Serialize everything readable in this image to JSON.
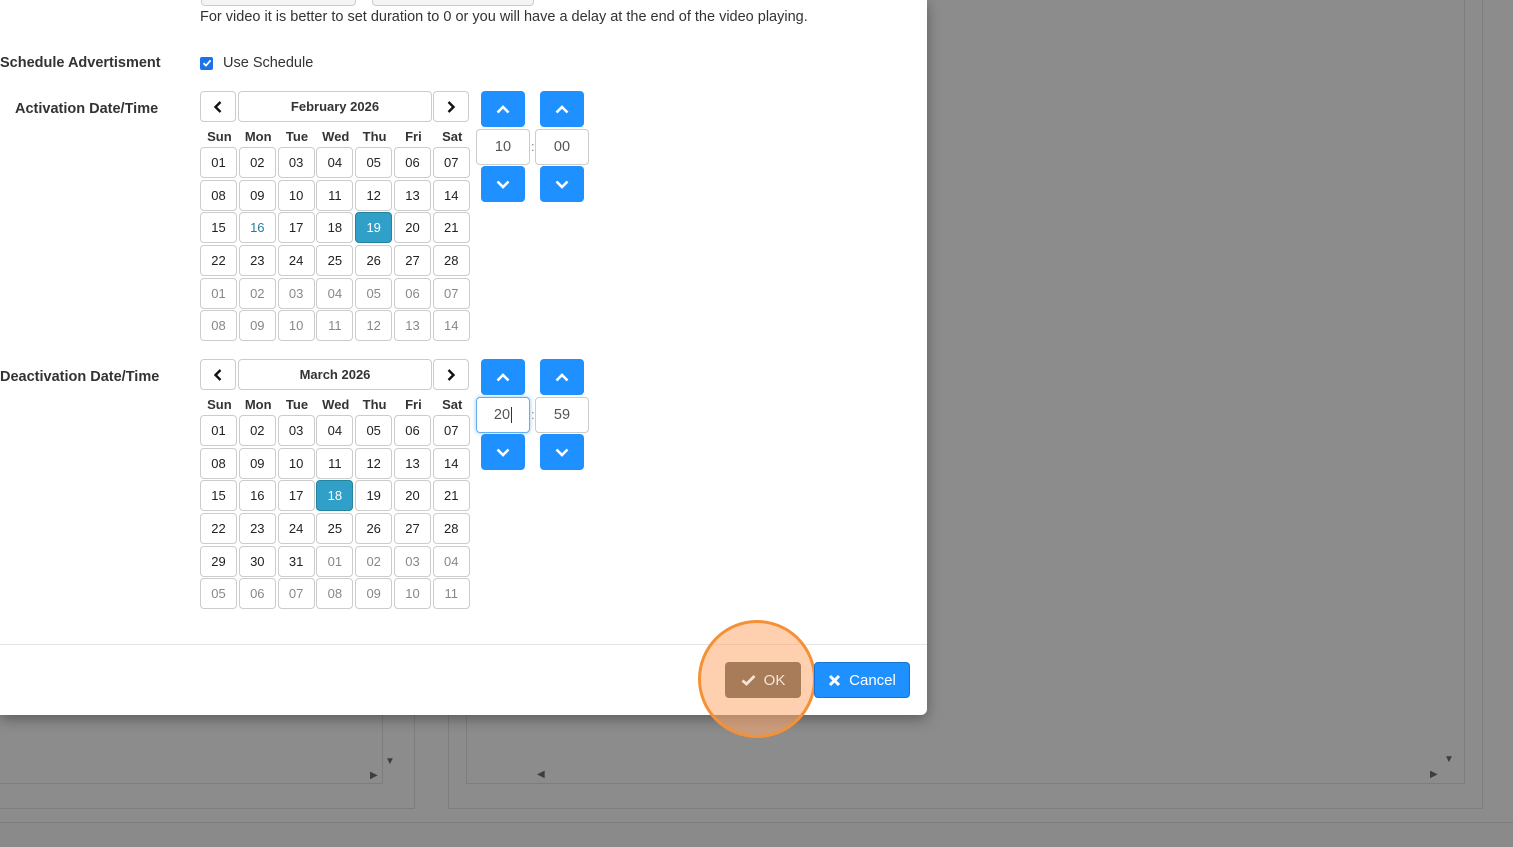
{
  "colors": {
    "accent": "#1e90ff",
    "selected_day": "#30a0c8",
    "highlight_ring": "#f59036",
    "ok_button": "#a87c59"
  },
  "help_text": "For video it is better to set duration to 0 or you will have a delay at the end of the video playing.",
  "schedule": {
    "label": "Schedule Advertisment",
    "checkbox_label": "Use Schedule",
    "checked": true
  },
  "activation": {
    "label": "Activation Date/Time",
    "calendar": {
      "month_label": "February 2026",
      "dows": [
        "Sun",
        "Mon",
        "Tue",
        "Wed",
        "Thu",
        "Fri",
        "Sat"
      ],
      "days": [
        {
          "d": "01",
          "s": "normal"
        },
        {
          "d": "02",
          "s": "normal"
        },
        {
          "d": "03",
          "s": "normal"
        },
        {
          "d": "04",
          "s": "normal"
        },
        {
          "d": "05",
          "s": "normal"
        },
        {
          "d": "06",
          "s": "normal"
        },
        {
          "d": "07",
          "s": "normal"
        },
        {
          "d": "08",
          "s": "normal"
        },
        {
          "d": "09",
          "s": "normal"
        },
        {
          "d": "10",
          "s": "normal"
        },
        {
          "d": "11",
          "s": "normal"
        },
        {
          "d": "12",
          "s": "normal"
        },
        {
          "d": "13",
          "s": "normal"
        },
        {
          "d": "14",
          "s": "normal"
        },
        {
          "d": "15",
          "s": "normal"
        },
        {
          "d": "16",
          "s": "today"
        },
        {
          "d": "17",
          "s": "normal"
        },
        {
          "d": "18",
          "s": "normal"
        },
        {
          "d": "19",
          "s": "selected"
        },
        {
          "d": "20",
          "s": "normal"
        },
        {
          "d": "21",
          "s": "normal"
        },
        {
          "d": "22",
          "s": "normal"
        },
        {
          "d": "23",
          "s": "normal"
        },
        {
          "d": "24",
          "s": "normal"
        },
        {
          "d": "25",
          "s": "normal"
        },
        {
          "d": "26",
          "s": "normal"
        },
        {
          "d": "27",
          "s": "normal"
        },
        {
          "d": "28",
          "s": "normal"
        },
        {
          "d": "01",
          "s": "muted"
        },
        {
          "d": "02",
          "s": "muted"
        },
        {
          "d": "03",
          "s": "muted"
        },
        {
          "d": "04",
          "s": "muted"
        },
        {
          "d": "05",
          "s": "muted"
        },
        {
          "d": "06",
          "s": "muted"
        },
        {
          "d": "07",
          "s": "muted"
        },
        {
          "d": "08",
          "s": "muted"
        },
        {
          "d": "09",
          "s": "muted"
        },
        {
          "d": "10",
          "s": "muted"
        },
        {
          "d": "11",
          "s": "muted"
        },
        {
          "d": "12",
          "s": "muted"
        },
        {
          "d": "13",
          "s": "muted"
        },
        {
          "d": "14",
          "s": "muted"
        }
      ]
    },
    "hour": "10",
    "minute": "00",
    "separator": ":"
  },
  "deactivation": {
    "label": "Deactivation Date/Time",
    "calendar": {
      "month_label": "March 2026",
      "dows": [
        "Sun",
        "Mon",
        "Tue",
        "Wed",
        "Thu",
        "Fri",
        "Sat"
      ],
      "days": [
        {
          "d": "01",
          "s": "normal"
        },
        {
          "d": "02",
          "s": "normal"
        },
        {
          "d": "03",
          "s": "normal"
        },
        {
          "d": "04",
          "s": "normal"
        },
        {
          "d": "05",
          "s": "normal"
        },
        {
          "d": "06",
          "s": "normal"
        },
        {
          "d": "07",
          "s": "normal"
        },
        {
          "d": "08",
          "s": "normal"
        },
        {
          "d": "09",
          "s": "normal"
        },
        {
          "d": "10",
          "s": "normal"
        },
        {
          "d": "11",
          "s": "normal"
        },
        {
          "d": "12",
          "s": "normal"
        },
        {
          "d": "13",
          "s": "normal"
        },
        {
          "d": "14",
          "s": "normal"
        },
        {
          "d": "15",
          "s": "normal"
        },
        {
          "d": "16",
          "s": "normal"
        },
        {
          "d": "17",
          "s": "normal"
        },
        {
          "d": "18",
          "s": "selected"
        },
        {
          "d": "19",
          "s": "normal"
        },
        {
          "d": "20",
          "s": "normal"
        },
        {
          "d": "21",
          "s": "normal"
        },
        {
          "d": "22",
          "s": "normal"
        },
        {
          "d": "23",
          "s": "normal"
        },
        {
          "d": "24",
          "s": "normal"
        },
        {
          "d": "25",
          "s": "normal"
        },
        {
          "d": "26",
          "s": "normal"
        },
        {
          "d": "27",
          "s": "normal"
        },
        {
          "d": "28",
          "s": "normal"
        },
        {
          "d": "29",
          "s": "normal"
        },
        {
          "d": "30",
          "s": "normal"
        },
        {
          "d": "31",
          "s": "normal"
        },
        {
          "d": "01",
          "s": "muted"
        },
        {
          "d": "02",
          "s": "muted"
        },
        {
          "d": "03",
          "s": "muted"
        },
        {
          "d": "04",
          "s": "muted"
        },
        {
          "d": "05",
          "s": "muted"
        },
        {
          "d": "06",
          "s": "muted"
        },
        {
          "d": "07",
          "s": "muted"
        },
        {
          "d": "08",
          "s": "muted"
        },
        {
          "d": "09",
          "s": "muted"
        },
        {
          "d": "10",
          "s": "muted"
        },
        {
          "d": "11",
          "s": "muted"
        }
      ]
    },
    "hour": "20",
    "minute": "59",
    "separator": ":"
  },
  "footer": {
    "ok_label": "OK",
    "cancel_label": "Cancel",
    "ok_icon": "check-icon",
    "cancel_icon": "close-icon"
  }
}
